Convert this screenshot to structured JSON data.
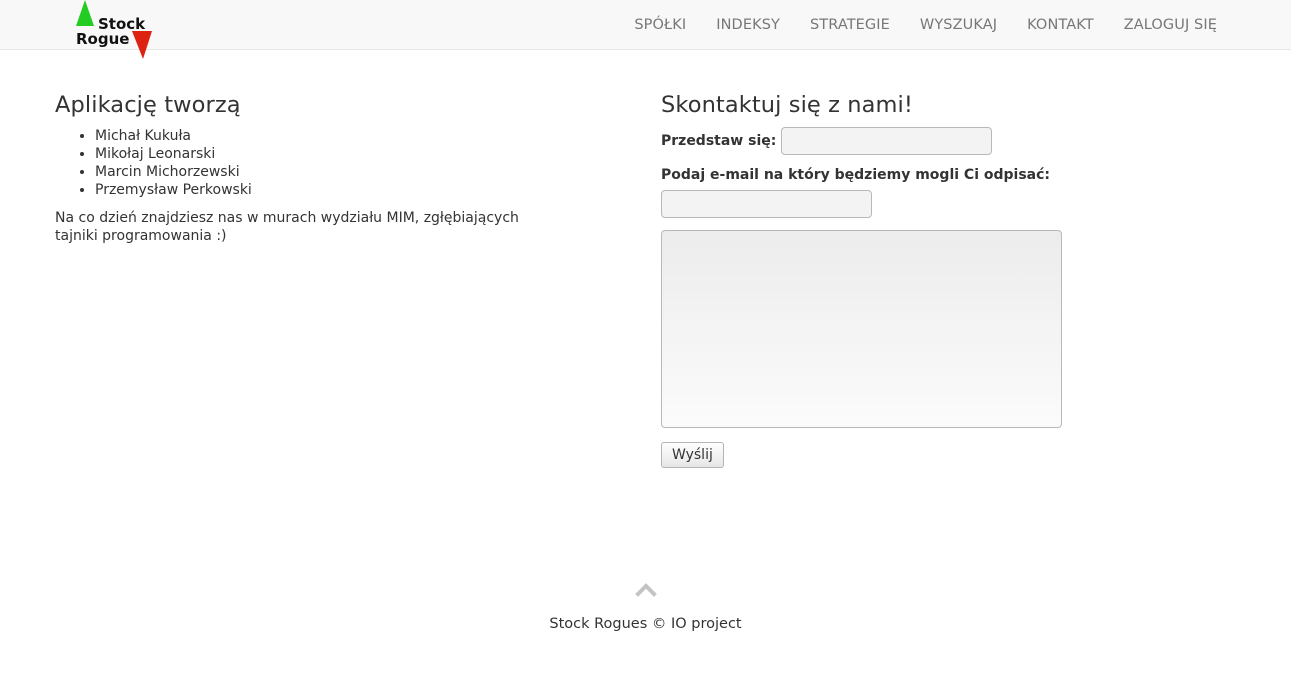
{
  "brand": {
    "line1": "Stock",
    "line2": "Rogue",
    "up_color": "#22cc22",
    "down_color": "#dd2211"
  },
  "nav": {
    "items": [
      {
        "label": "SPÓŁKI"
      },
      {
        "label": "INDEKSY"
      },
      {
        "label": "STRATEGIE"
      },
      {
        "label": "WYSZUKAJ"
      },
      {
        "label": "KONTAKT"
      },
      {
        "label": "ZALOGUJ SIĘ"
      }
    ]
  },
  "about": {
    "title": "Aplikację tworzą",
    "authors": [
      "Michał Kukuła",
      "Mikołaj Leonarski",
      "Marcin Michorzewski",
      "Przemysław Perkowski"
    ],
    "description": "Na co dzień znajdziesz nas w murach wydziału MIM, zgłębiających tajniki programowania :)"
  },
  "contact": {
    "title": "Skontaktuj się z nami!",
    "name_label": "Przedstaw się:",
    "name_value": "",
    "email_label": "Podaj e-mail na który będziemy mogli Ci odpisać:",
    "email_value": "",
    "message_value": "",
    "send_label": "Wyślij"
  },
  "footer": {
    "back_to_top_icon": "chevron-up-icon",
    "text": "Stock Rogues © IO project"
  }
}
